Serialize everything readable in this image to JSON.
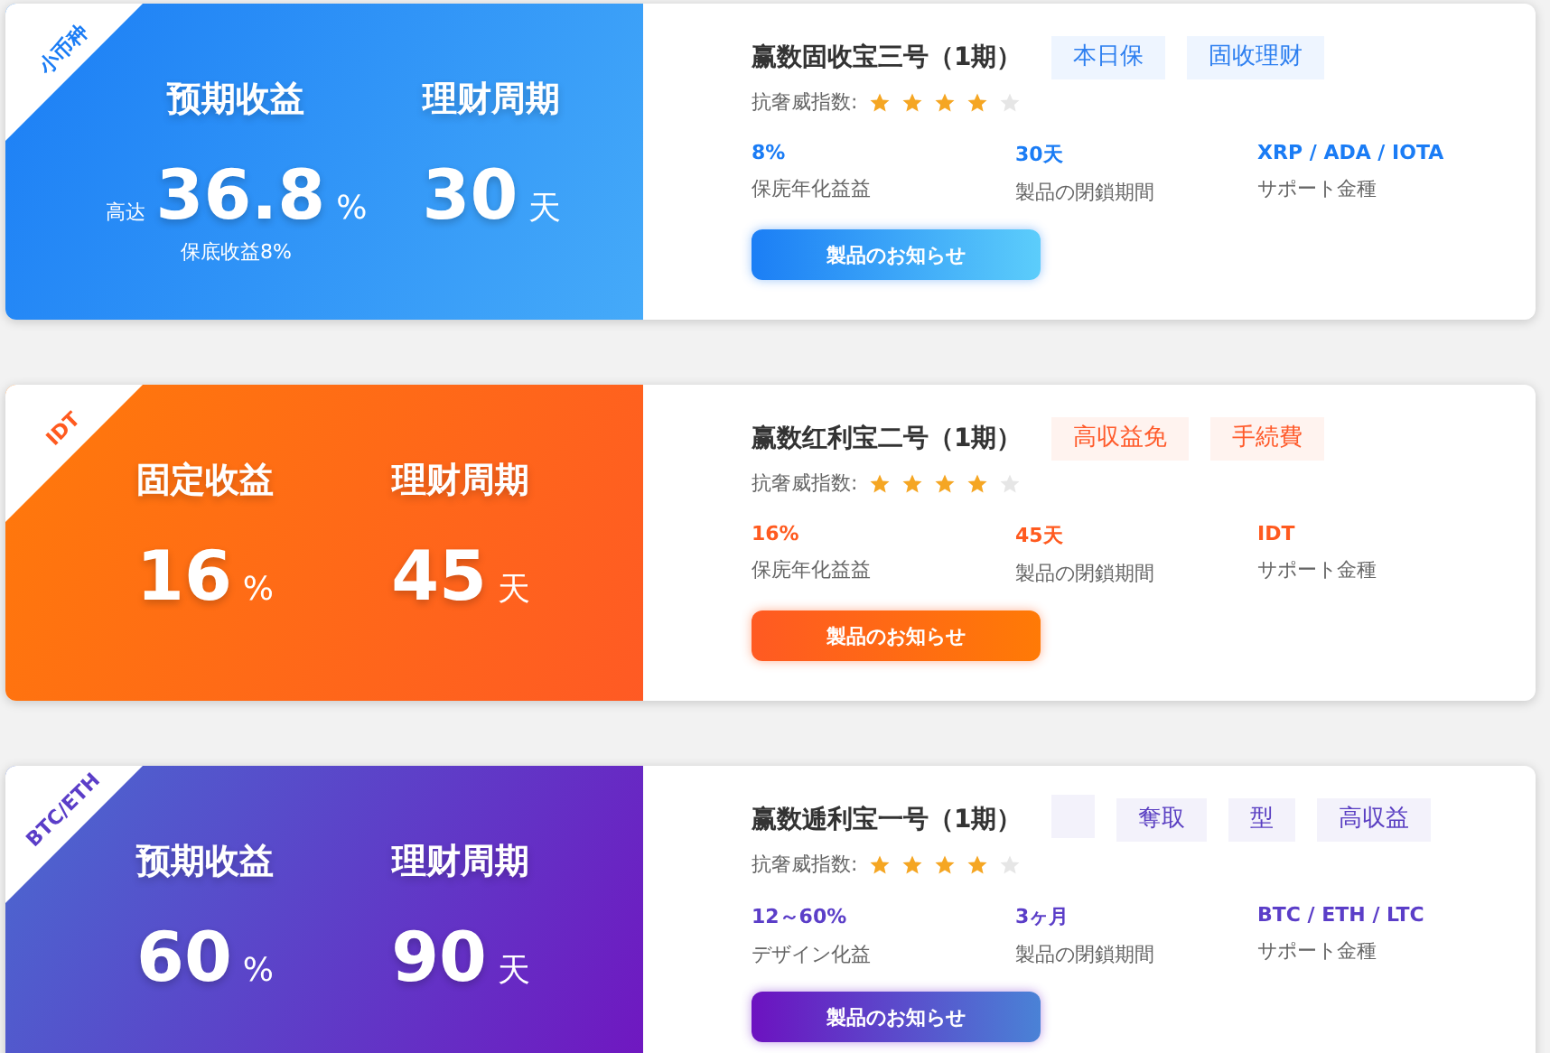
{
  "cards": [
    {
      "kind": "blue",
      "ribbon": "小币种",
      "yield_label": "预期收益",
      "yield_prefix": "高达",
      "yield_value": "36.8",
      "yield_unit": "%",
      "yield_note": "保底收益8%",
      "term_label": "理财周期",
      "term_value": "30",
      "term_unit": "天",
      "title": "赢数固收宝三号（1期）",
      "tags": [
        {
          "kind": "text",
          "label": "本日保"
        },
        {
          "kind": "text",
          "label": "固收理财"
        }
      ],
      "rating_label": "抗奢威指数:",
      "stars": 4,
      "stats": [
        {
          "value": "8%",
          "label": "保庑年化益益"
        },
        {
          "value": "30天",
          "label": "製品の閉鎖期間"
        },
        {
          "value": "XRP / ADA / IOTA",
          "label": "サポート金種"
        }
      ],
      "button": "製品のお知らせ"
    },
    {
      "kind": "orange",
      "ribbon": "IDT",
      "yield_label": "固定收益",
      "yield_value": "16",
      "yield_unit": "%",
      "term_label": "理财周期",
      "term_value": "45",
      "term_unit": "天",
      "title": "赢数红利宝二号（1期）",
      "tags": [
        {
          "kind": "text",
          "label": "高収益免"
        },
        {
          "kind": "text",
          "label": "手続費"
        }
      ],
      "rating_label": "抗奢威指数:",
      "stars": 4,
      "stats": [
        {
          "value": "16%",
          "label": "保庑年化益益"
        },
        {
          "value": "45天",
          "label": "製品の閉鎖期間"
        },
        {
          "value": "IDT",
          "label": "サポート金種"
        }
      ],
      "button": "製品のお知らせ"
    },
    {
      "kind": "purple",
      "ribbon": "BTC/ETH",
      "yield_label": "预期收益",
      "yield_value": "60",
      "yield_unit": "%",
      "term_label": "理财周期",
      "term_value": "90",
      "term_unit": "天",
      "title": "赢数逓利宝一号（1期）",
      "tags": [
        {
          "kind": "blank"
        },
        {
          "kind": "text",
          "label": "奪取"
        },
        {
          "kind": "text",
          "label": "型"
        },
        {
          "kind": "text",
          "label": "高収益"
        }
      ],
      "rating_label": "抗奢威指数:",
      "stars": 4,
      "stats": [
        {
          "value": "12～60%",
          "label": "デザイン化益"
        },
        {
          "value": "3ヶ月",
          "label": "製品の閉鎖期間"
        },
        {
          "value": "BTC / ETH / LTC",
          "label": "サポート金種"
        }
      ],
      "button": "製品のお知らせ"
    }
  ]
}
